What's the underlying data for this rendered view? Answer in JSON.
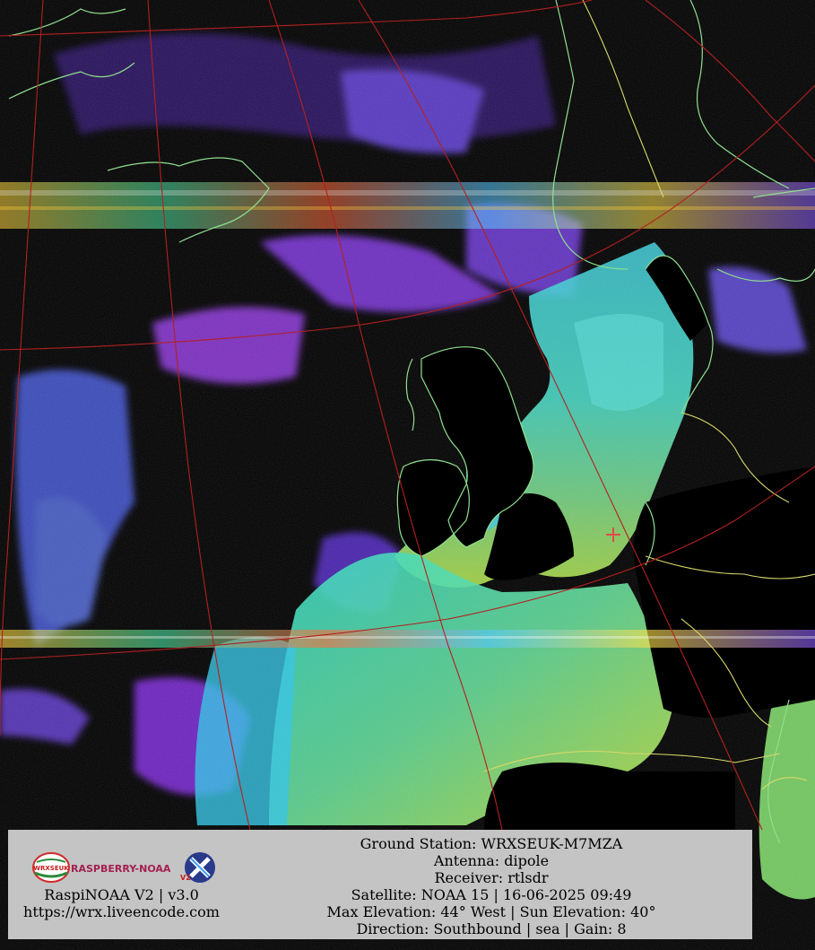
{
  "caption": {
    "left": {
      "logo_badge": "WRXSEUK",
      "logo_wordmark": "RASPBERRY-NOAA",
      "logo_suffix": "V2",
      "line1": "RaspiNOAA V2 | v3.0",
      "line2": "https://wrx.liveencode.com"
    },
    "lines": [
      "Ground Station: WRXSEUK-M7MZA",
      "Antenna: dipole",
      "Receiver: rtlsdr",
      "Satellite: NOAA 15 | 16-06-2025 09:49",
      "Max Elevation: 44° West | Sun Elevation: 40°",
      "Direction: Southbound | sea | Gain: 8"
    ]
  },
  "colors": {
    "graticule": "#b42020",
    "coastline": "#8fdf8f",
    "border": "#d9d96a",
    "station_marker": "#e04a4a",
    "caption_background": "#c4c4c4"
  }
}
